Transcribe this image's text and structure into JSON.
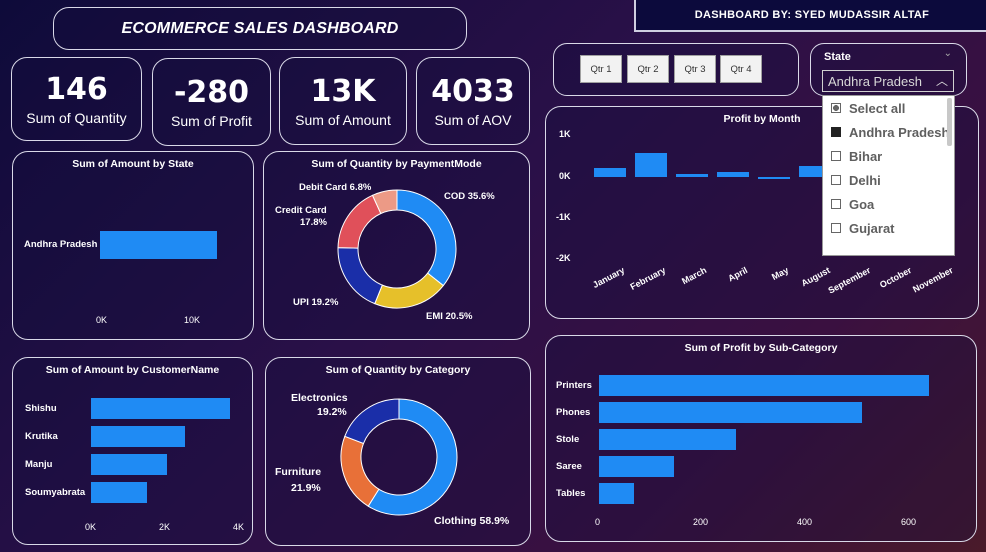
{
  "header": {
    "title": "ECOMMERCE SALES DASHBOARD",
    "author": "DASHBOARD BY: SYED MUDASSIR ALTAF"
  },
  "kpis": [
    {
      "value": "146",
      "label": "Sum of Quantity"
    },
    {
      "value": "-280",
      "label": "Sum of Profit"
    },
    {
      "value": "13K",
      "label": "Sum of Amount"
    },
    {
      "value": "4033",
      "label": "Sum of AOV"
    }
  ],
  "quarters": [
    "Qtr 1",
    "Qtr 2",
    "Qtr 3",
    "Qtr 4"
  ],
  "state_filter": {
    "label": "State",
    "selected": "Andhra Pradesh",
    "options": [
      "Select all",
      "Andhra Pradesh",
      "Bihar",
      "Delhi",
      "Goa",
      "Gujarat"
    ],
    "checked": [
      false,
      true,
      false,
      false,
      false,
      false
    ]
  },
  "colors": {
    "bar": "#1f8bf4",
    "cod": "#1f8bf4",
    "emi": "#e6c02a",
    "upi": "#1a2ea8",
    "credit": "#e0505a",
    "debit": "#ec9a86",
    "clothing": "#1f8bf4",
    "furniture": "#e87038",
    "electronics": "#1a2ea8"
  },
  "chart_data": [
    {
      "type": "bar",
      "title": "Sum of Amount by State",
      "categories": [
        "Andhra Pradesh"
      ],
      "values": [
        13000
      ],
      "xticks": [
        "0K",
        "10K"
      ],
      "xlim": [
        0,
        16000
      ]
    },
    {
      "type": "pie",
      "title": "Sum of Quantity by PaymentMode",
      "labels": [
        "COD",
        "EMI",
        "UPI",
        "Credit Card",
        "Debit Card"
      ],
      "values": [
        35.6,
        20.5,
        19.2,
        17.8,
        6.8
      ],
      "display": [
        "COD 35.6%",
        "EMI 20.5%",
        "UPI 19.2%",
        "Credit Card",
        "17.8%",
        "Debit Card 6.8%"
      ]
    },
    {
      "type": "bar",
      "title": "Profit by Month",
      "categories": [
        "January",
        "February",
        "March",
        "April",
        "May",
        "August",
        "September",
        "October",
        "November"
      ],
      "values": [
        220,
        580,
        80,
        110,
        -20,
        270,
        0,
        0,
        0
      ],
      "yticks": [
        "1K",
        "0K",
        "-1K",
        "-2K"
      ],
      "ylim": [
        -2000,
        1000
      ]
    },
    {
      "type": "bar",
      "title": "Sum of Amount by CustomerName",
      "categories": [
        "Shishu",
        "Krutika",
        "Manju",
        "Soumyabrata"
      ],
      "values": [
        3750,
        2550,
        2050,
        1500
      ],
      "xticks": [
        "0K",
        "2K",
        "4K"
      ],
      "xlim": [
        0,
        4000
      ]
    },
    {
      "type": "pie",
      "title": "Sum of Quantity by Category",
      "labels": [
        "Clothing",
        "Furniture",
        "Electronics"
      ],
      "values": [
        58.9,
        21.9,
        19.2
      ],
      "display": [
        "Electronics",
        "19.2%",
        "Furniture",
        "21.9%",
        "Clothing 58.9%"
      ]
    },
    {
      "type": "bar",
      "title": "Sum of Profit by Sub-Category",
      "categories": [
        "Printers",
        "Phones",
        "Stole",
        "Saree",
        "Tables"
      ],
      "values": [
        640,
        510,
        265,
        145,
        68
      ],
      "xticks": [
        "0",
        "200",
        "400",
        "600"
      ],
      "xlim": [
        0,
        650
      ]
    }
  ]
}
